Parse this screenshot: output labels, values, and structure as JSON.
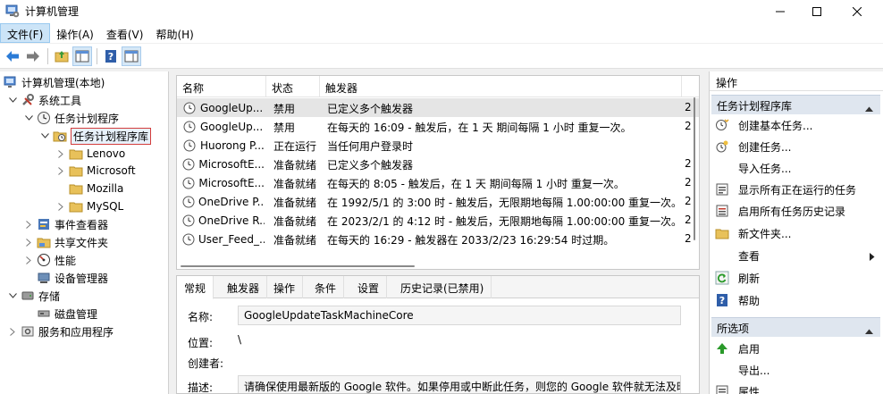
{
  "window": {
    "title": "计算机管理"
  },
  "menu": [
    "文件(F)",
    "操作(A)",
    "查看(V)",
    "帮助(H)"
  ],
  "tree": [
    {
      "label": "计算机管理(本地)",
      "level": 0,
      "icon": "computer-icon",
      "chevron": "none"
    },
    {
      "label": "系统工具",
      "level": 1,
      "icon": "tools-icon",
      "chevron": "expanded"
    },
    {
      "label": "任务计划程序",
      "level": 2,
      "icon": "clock-icon",
      "chevron": "expanded"
    },
    {
      "label": "任务计划程序库",
      "level": 3,
      "icon": "folder-clock-icon",
      "chevron": "expanded",
      "selected": true
    },
    {
      "label": "Lenovo",
      "level": 4,
      "icon": "folder-icon",
      "chevron": "collapsed"
    },
    {
      "label": "Microsoft",
      "level": 4,
      "icon": "folder-icon",
      "chevron": "collapsed"
    },
    {
      "label": "Mozilla",
      "level": 4,
      "icon": "folder-icon",
      "chevron": "none"
    },
    {
      "label": "MySQL",
      "level": 4,
      "icon": "folder-icon",
      "chevron": "collapsed"
    },
    {
      "label": "事件查看器",
      "level": 2,
      "icon": "event-viewer-icon",
      "chevron": "collapsed"
    },
    {
      "label": "共享文件夹",
      "level": 2,
      "icon": "shared-folder-icon",
      "chevron": "collapsed"
    },
    {
      "label": "性能",
      "level": 2,
      "icon": "performance-icon",
      "chevron": "collapsed"
    },
    {
      "label": "设备管理器",
      "level": 2,
      "icon": "device-manager-icon",
      "chevron": "none"
    },
    {
      "label": "存储",
      "level": 1,
      "icon": "storage-icon",
      "chevron": "expanded"
    },
    {
      "label": "磁盘管理",
      "level": 2,
      "icon": "disk-icon",
      "chevron": "none"
    },
    {
      "label": "服务和应用程序",
      "level": 1,
      "icon": "services-icon",
      "chevron": "collapsed"
    }
  ],
  "task_list": {
    "columns": [
      "名称",
      "状态",
      "触发器"
    ],
    "rows": [
      {
        "name": "GoogleUp...",
        "status": "禁用",
        "trigger": "已定义多个触发器",
        "extra": "2"
      },
      {
        "name": "GoogleUp...",
        "status": "禁用",
        "trigger": "在每天的 16:09 - 触发后，在 1 天 期间每隔 1 小时 重复一次。",
        "extra": "2"
      },
      {
        "name": "Huorong P...",
        "status": "正在运行",
        "trigger": "当任何用户登录时",
        "extra": ""
      },
      {
        "name": "MicrosoftE...",
        "status": "准备就绪",
        "trigger": "已定义多个触发器",
        "extra": "2"
      },
      {
        "name": "MicrosoftE...",
        "status": "准备就绪",
        "trigger": "在每天的 8:05 - 触发后，在 1 天 期间每隔 1 小时 重复一次。",
        "extra": "2"
      },
      {
        "name": "OneDrive P...",
        "status": "准备就绪",
        "trigger": "在 1992/5/1 的 3:00 时 - 触发后，无限期地每隔 1.00:00:00 重复一次。",
        "extra": "2"
      },
      {
        "name": "OneDrive R...",
        "status": "准备就绪",
        "trigger": "在 2023/2/1 的 4:12 时 - 触发后，无限期地每隔 1.00:00:00 重复一次。",
        "extra": "2"
      },
      {
        "name": "User_Feed_...",
        "status": "准备就绪",
        "trigger": "在每天的 16:29 - 触发器在 2033/2/23 16:29:54 时过期。",
        "extra": "2"
      }
    ]
  },
  "detail": {
    "tabs": [
      "常规",
      "触发器",
      "操作",
      "条件",
      "设置",
      "历史记录(已禁用)"
    ],
    "fields": {
      "name_label": "名称:",
      "name_value": "GoogleUpdateTaskMachineCore",
      "location_label": "位置:",
      "location_value": "\\",
      "author_label": "创建者:",
      "author_value": "",
      "desc_label": "描述:",
      "desc_value": "请确保使用最新版的 Google 软件。如果停用或中断此任务，则您的 Google 软件就无法及时"
    }
  },
  "actions": {
    "title": "操作",
    "groups": [
      {
        "label": "任务计划程序库",
        "items": [
          {
            "label": "创建基本任务...",
            "icon": "create-basic-task-icon"
          },
          {
            "label": "创建任务...",
            "icon": "create-task-icon"
          },
          {
            "label": "导入任务...",
            "icon": ""
          },
          {
            "label": "显示所有正在运行的任务",
            "icon": "running-tasks-icon"
          },
          {
            "label": "启用所有任务历史记录",
            "icon": "history-icon"
          },
          {
            "label": "新文件夹...",
            "icon": "new-folder-icon"
          },
          {
            "label": "查看",
            "icon": "",
            "submenu": true
          },
          {
            "label": "刷新",
            "icon": "refresh-icon"
          },
          {
            "label": "帮助",
            "icon": "help-icon"
          }
        ]
      },
      {
        "label": "所选项",
        "items": [
          {
            "label": "启用",
            "icon": "enable-icon"
          },
          {
            "label": "导出...",
            "icon": ""
          },
          {
            "label": "属性",
            "icon": "properties-icon"
          }
        ]
      }
    ]
  }
}
